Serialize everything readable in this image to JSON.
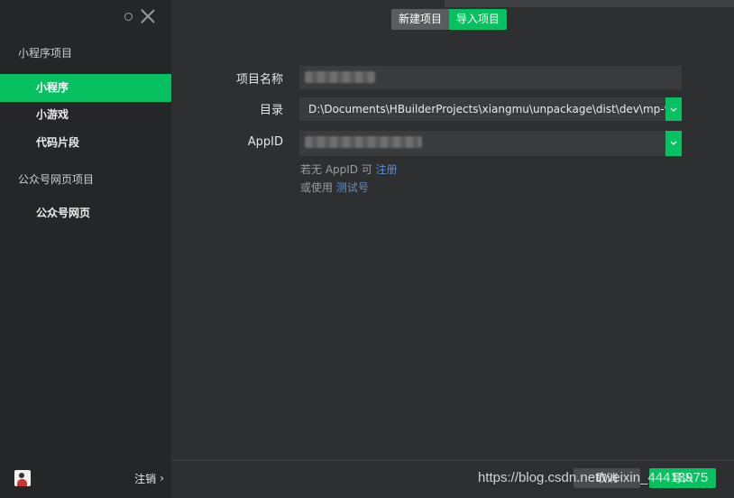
{
  "window": {
    "controls": [
      "minimize-circle-icon",
      "close-icon"
    ]
  },
  "sidebar": {
    "group1_label": "小程序项目",
    "group1_items": [
      {
        "label": "小程序",
        "active": true
      },
      {
        "label": "小游戏",
        "active": false
      },
      {
        "label": "代码片段",
        "active": false
      }
    ],
    "group2_label": "公众号网页项目",
    "group2_items": [
      {
        "label": "公众号网页",
        "active": false
      }
    ],
    "logout_label": "注销",
    "logout_icon": "chevron-right-icon"
  },
  "header": {
    "tabs": [
      {
        "label": "新建项目",
        "active": false
      },
      {
        "label": "导入项目",
        "active": true
      }
    ]
  },
  "form": {
    "project_name_label": "项目名称",
    "dir_label": "目录",
    "dir_value": "D:\\Documents\\HBuilderProjects\\xiangmu\\unpackage\\dist\\dev\\mp-weixin",
    "appid_label": "AppID",
    "hint1_prefix": "若无 AppID 可 ",
    "hint1_link": "注册",
    "hint2_prefix": "或使用 ",
    "hint2_link": "测试号"
  },
  "footer": {
    "cancel_label": "取消",
    "import_label": "导入"
  },
  "watermark": "https://blog.csdn.net/weixin_44413975",
  "colors": {
    "accent": "#07c160",
    "sidebar_bg": "#252627",
    "main_bg": "#2e2f30",
    "link": "#5b8cd1"
  }
}
